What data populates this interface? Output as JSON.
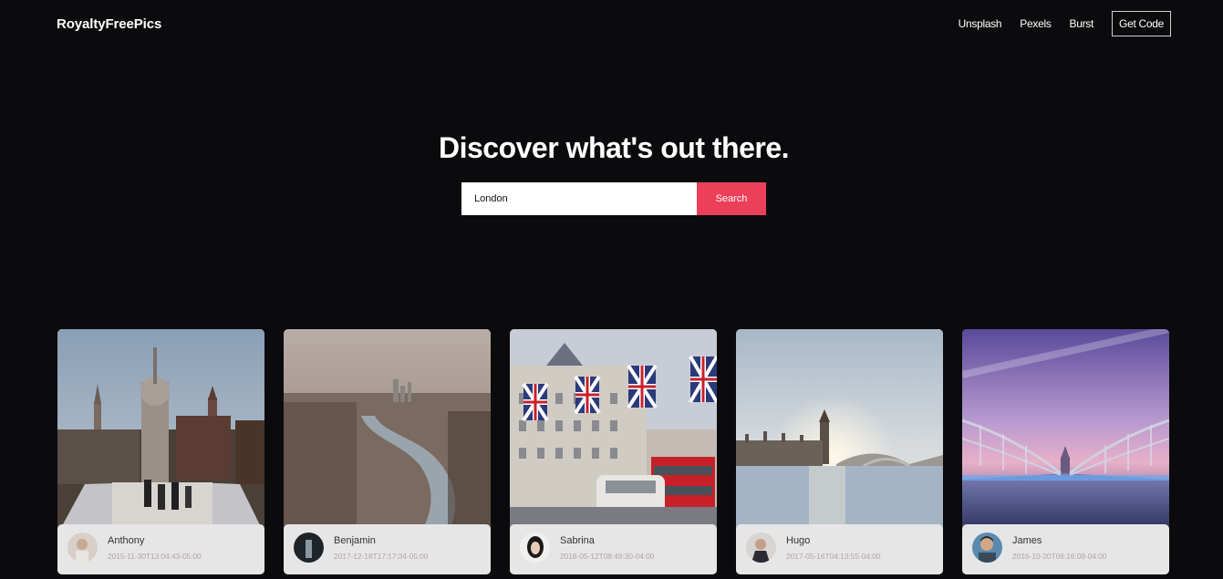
{
  "brand": "RoyaltyFreePics",
  "nav": {
    "links": [
      "Unsplash",
      "Pexels",
      "Burst"
    ],
    "cta": "Get Code"
  },
  "hero": {
    "title": "Discover what's out there."
  },
  "search": {
    "value": "London",
    "button": "Search"
  },
  "photos": [
    {
      "author": "Anthony",
      "date": "2015-11-30T13:04:43-05:00",
      "image_icon": "st-pauls-cathedral"
    },
    {
      "author": "Benjamin",
      "date": "2017-12-18T17:17:34-05:00",
      "image_icon": "thames-aerial-view"
    },
    {
      "author": "Sabrina",
      "date": "2018-05-12T08:49:30-04:00",
      "image_icon": "regent-street-union-jacks"
    },
    {
      "author": "Hugo",
      "date": "2017-05-16T04:13:55-04:00",
      "image_icon": "big-ben-sunrise"
    },
    {
      "author": "James",
      "date": "2016-10-20T06:16:08-04:00",
      "image_icon": "millennium-bridge-dusk"
    }
  ],
  "colors": {
    "background": "#0b0b0e",
    "accent": "#ec3f5a",
    "card_footer": "#e6e6e6"
  }
}
